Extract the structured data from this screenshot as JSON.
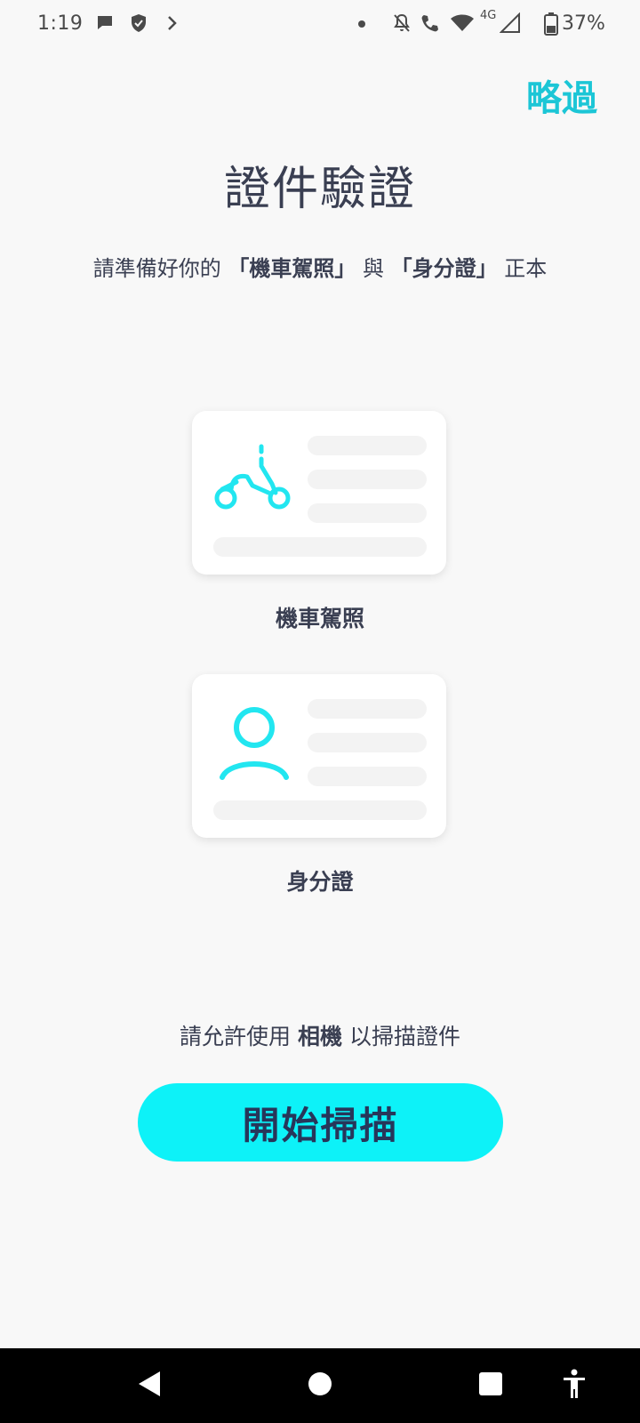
{
  "status_bar": {
    "time": "1:19",
    "battery": "37%",
    "network": "4G"
  },
  "header": {
    "skip_label": "略過",
    "title": "證件驗證"
  },
  "subtitle": {
    "prefix": "請準備好你的",
    "doc1": "「機車駕照」",
    "joiner": "與",
    "doc2": "「身分證」",
    "suffix": "正本"
  },
  "cards": [
    {
      "label": "機車駕照",
      "icon": "scooter-icon"
    },
    {
      "label": "身分證",
      "icon": "person-icon"
    }
  ],
  "permission": {
    "prefix": "請允許使用",
    "highlight": "相機",
    "suffix": "以掃描證件"
  },
  "start_button": {
    "label": "開始掃描"
  },
  "colors": {
    "accent": "#0df2f8",
    "skip": "#1cc6d6",
    "text": "#3a3f52",
    "background": "#f8f8f8",
    "illustration": "#22e6f0"
  }
}
